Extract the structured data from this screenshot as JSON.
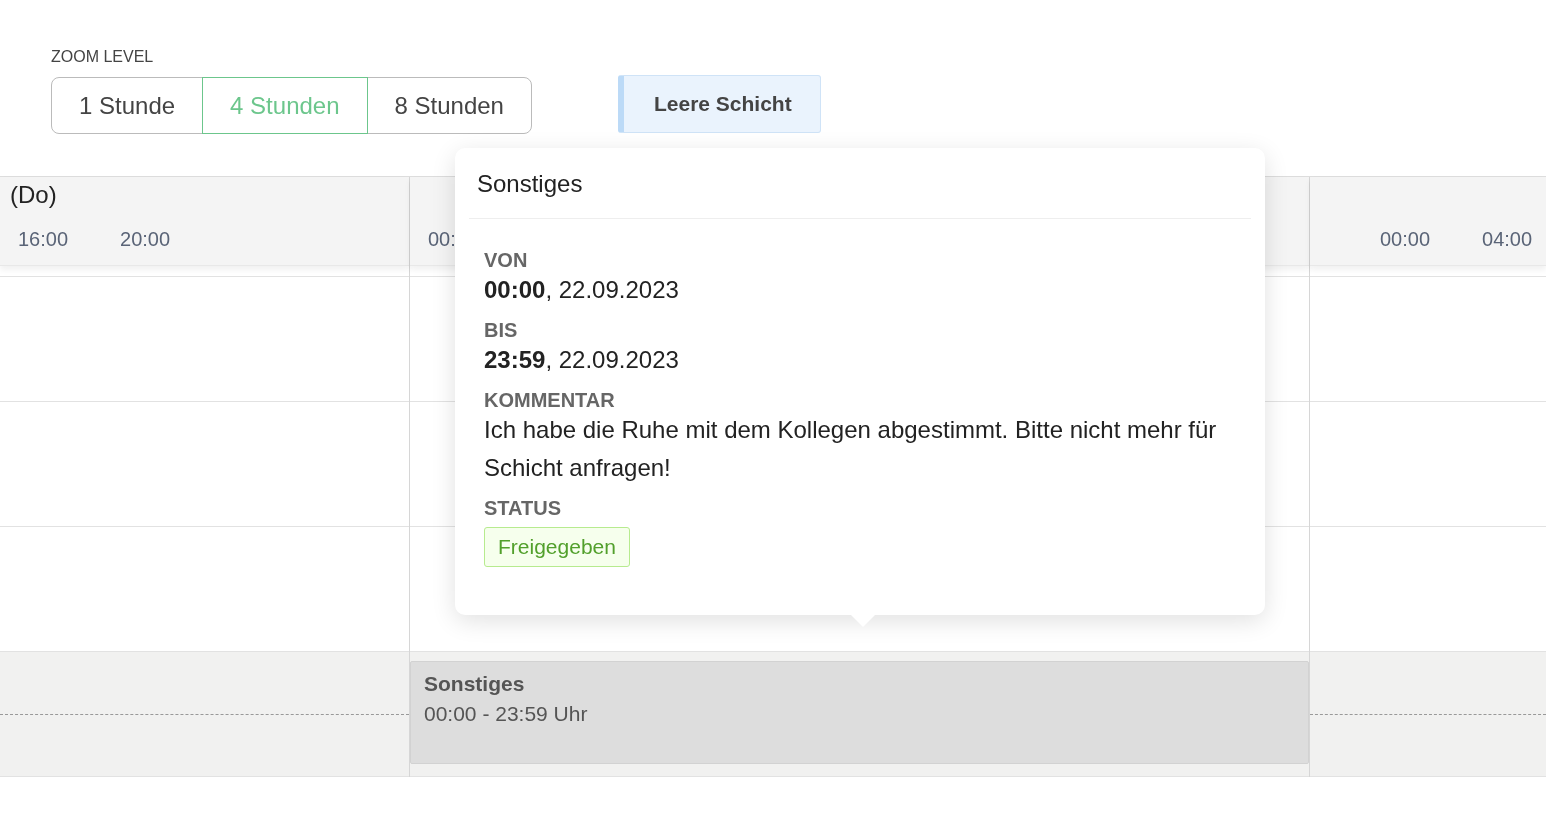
{
  "zoom": {
    "label": "ZOOM LEVEL",
    "options": [
      {
        "label": "1 Stunde",
        "selected": false
      },
      {
        "label": "4 Stunden",
        "selected": true
      },
      {
        "label": "8 Stunden",
        "selected": false
      }
    ]
  },
  "empty_shift_button": "Leere Schicht",
  "days": [
    {
      "title": "(Do)",
      "ticks": [
        "16:00",
        "20:00"
      ]
    },
    {
      "ticks": [
        "00:"
      ],
      "event": {
        "title": "Sonstiges",
        "time": "00:00 - 23:59 Uhr"
      }
    },
    {
      "ticks": [
        "00:00",
        "04:00"
      ]
    }
  ],
  "popover": {
    "title": "Sonstiges",
    "fields": [
      {
        "label": "VON",
        "kind": "text",
        "value": "**00:00**, 22.09.2023"
      },
      {
        "label": "BIS",
        "kind": "text",
        "value": "**23:59**, 22.09.2023"
      },
      {
        "label": "KOMMENTAR",
        "kind": "text",
        "value": "Ich habe die Ruhe mit dem Kollegen abgestimmt. Bitte nicht mehr für Schicht anfragen!"
      },
      {
        "label": "STATUS",
        "kind": "tag",
        "value": "Freigegeben"
      }
    ]
  }
}
